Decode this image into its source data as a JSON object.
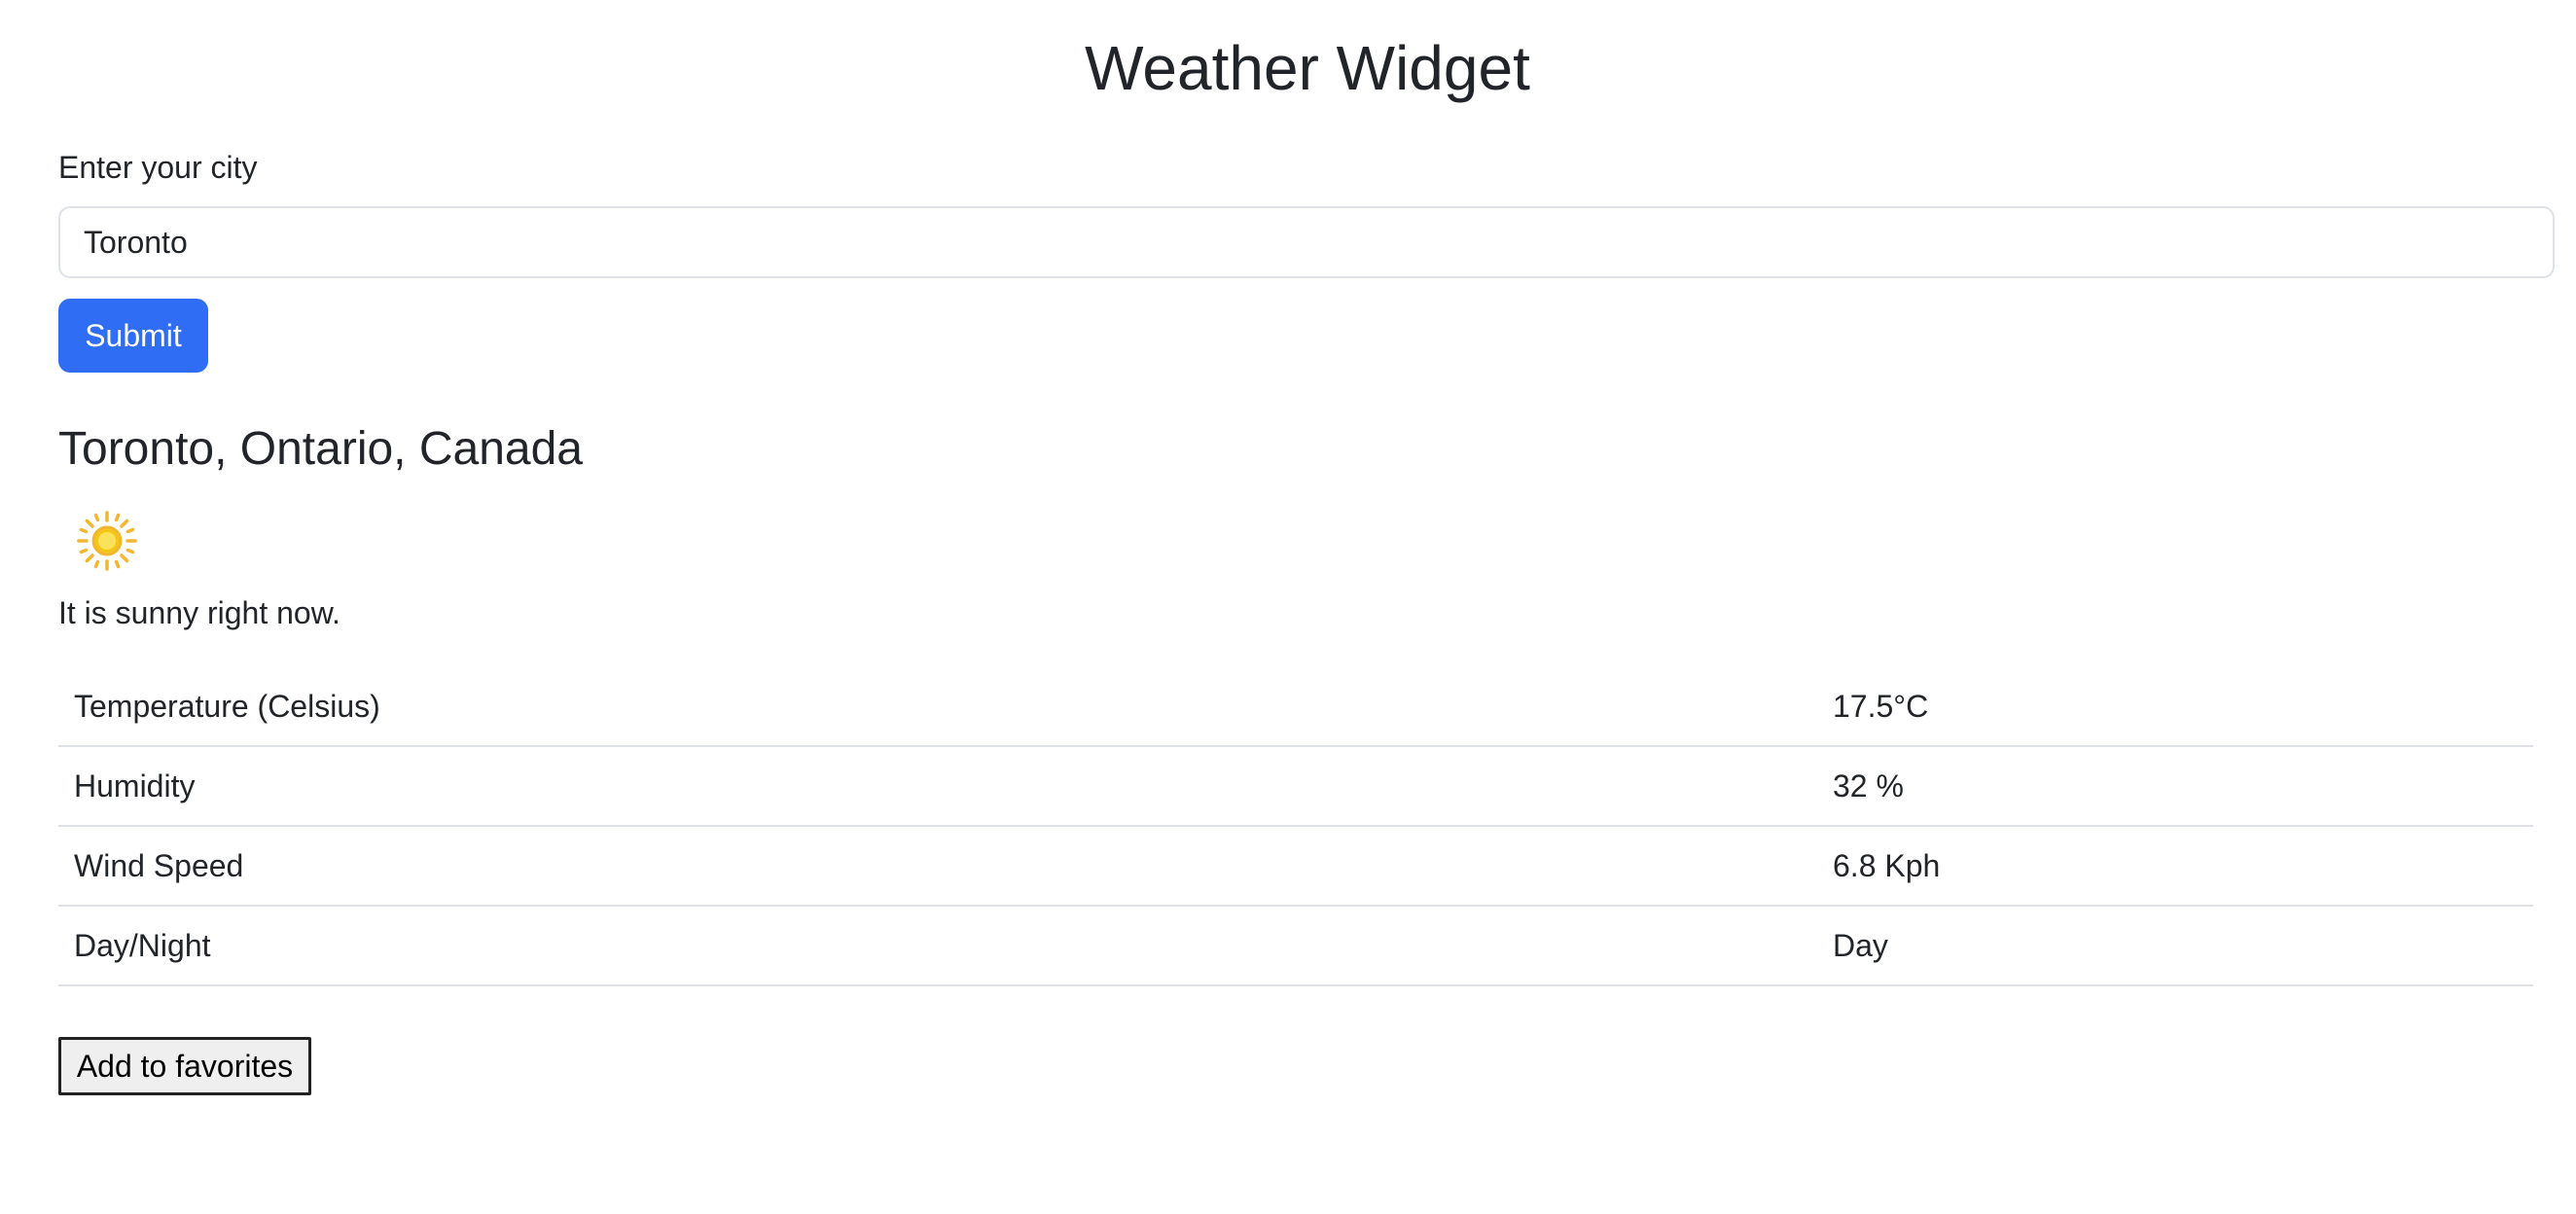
{
  "header": {
    "title": "Weather Widget"
  },
  "search": {
    "label": "Enter your city",
    "value": "Toronto",
    "placeholder": "",
    "submit_label": "Submit"
  },
  "result": {
    "location": "Toronto, Ontario, Canada",
    "icon": "sun-icon",
    "condition_text": "It is sunny right now.",
    "stats": [
      {
        "label": "Temperature (Celsius)",
        "value": "17.5°C"
      },
      {
        "label": "Humidity",
        "value": "32 %"
      },
      {
        "label": "Wind Speed",
        "value": "6.8 Kph"
      },
      {
        "label": "Day/Night",
        "value": "Day"
      }
    ],
    "favorites_label": "Add to favorites"
  },
  "colors": {
    "primary_button": "#2f6df5",
    "text": "#212529",
    "border": "#dee2e6",
    "sun": "#f5c518"
  }
}
